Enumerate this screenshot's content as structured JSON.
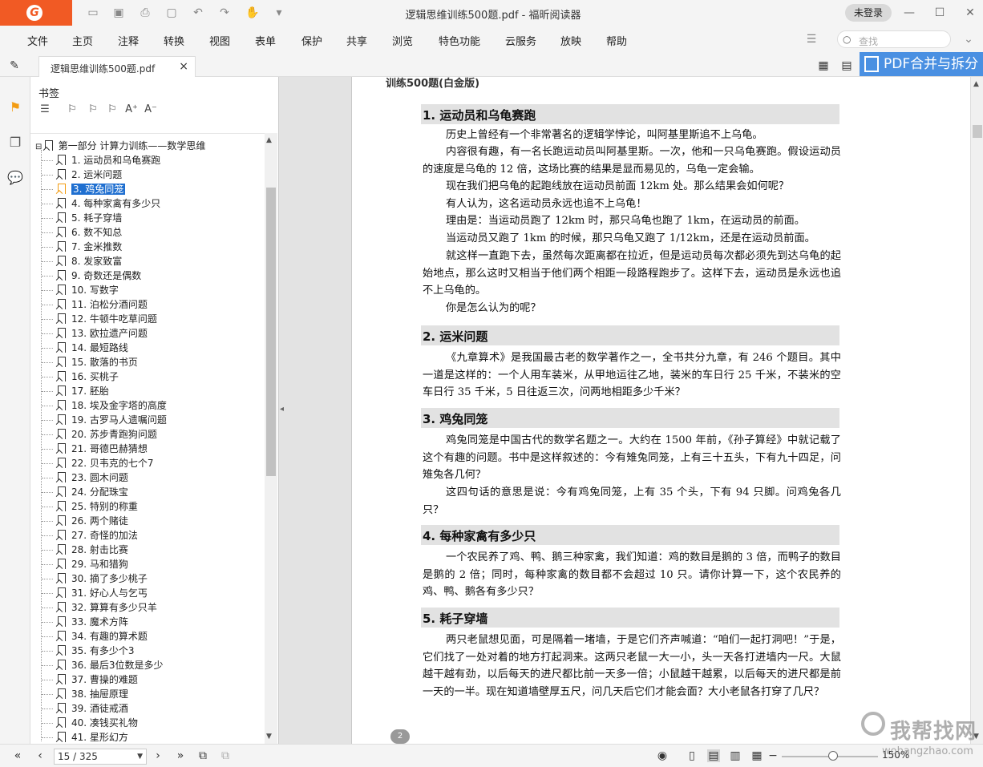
{
  "titlebar": {
    "logo": "foxit-logo",
    "quick_access_icons": [
      "open-icon",
      "save-icon",
      "print-icon",
      "new-icon",
      "undo-icon",
      "redo-icon",
      "hand-tool-icon",
      "customize-icon"
    ],
    "title": "逻辑思维训练500题.pdf - 福昕阅读器",
    "login": "未登录",
    "window_buttons": {
      "minimize": "—",
      "maximize": "☐",
      "close": "✕"
    }
  },
  "menu": {
    "items": [
      "文件",
      "主页",
      "注释",
      "转换",
      "视图",
      "表单",
      "保护",
      "共享",
      "浏览",
      "特色功能",
      "云服务",
      "放映",
      "帮助"
    ],
    "search_placeholder": "查找"
  },
  "tabs": {
    "doc_tab": "逻辑思维训练500题.pdf",
    "close": "×",
    "promo": "PDF合并与拆分"
  },
  "bookmarks": {
    "title": "书签",
    "root": "第一部分 计算力训练——数学思维",
    "selected_index": 2,
    "items": [
      "1. 运动员和乌龟赛跑",
      "2. 运米问题",
      "3. 鸡兔同笼",
      "4. 每种家禽有多少只",
      "5. 耗子穿墙",
      "6. 数不知总",
      "7. 金米推数",
      "8. 发家致富",
      "9. 奇数还是偶数",
      "10. 写数字",
      "11. 泊松分酒问题",
      "12. 牛顿牛吃草问题",
      "13. 欧拉遗产问题",
      "14. 最短路线",
      "15. 散落的书页",
      "16. 买桃子",
      "17. 胚胎",
      "18. 埃及金字塔的高度",
      "19. 古罗马人遗嘱问题",
      "20. 苏步青跑狗问题",
      "21. 哥德巴赫猜想",
      "22. 贝韦克的七个7",
      "23. 圆木问题",
      "24. 分配珠宝",
      "25. 特别的称重",
      "26. 两个赌徒",
      "27. 奇怪的加法",
      "28. 射击比赛",
      "29. 马和猎狗",
      "30. 摘了多少桃子",
      "31. 好心人与乞丐",
      "32. 算算有多少只羊",
      "33. 魔术方阵",
      "34. 有趣的算术题",
      "35. 有多少个3",
      "36. 最后3位数是多少",
      "37. 曹操的难题",
      "38. 抽屉原理",
      "39. 酒徒戒酒",
      "40. 凑钱买礼物",
      "41. 星形幻方"
    ]
  },
  "page": {
    "header": "训练500题(白金版)",
    "page_mark": "2",
    "sections": [
      {
        "title": "1. 运动员和乌龟赛跑",
        "paragraphs": [
          "历史上曾经有一个非常著名的逻辑学悖论，叫阿基里斯追不上乌龟。",
          "内容很有趣，有一名长跑运动员叫阿基里斯。一次，他和一只乌龟赛跑。假设运动员的速度是乌龟的 12 倍，这场比赛的结果是显而易见的，乌龟一定会输。",
          "现在我们把乌龟的起跑线放在运动员前面 12km 处。那么结果会如何呢？",
          "有人认为，这名运动员永远也追不上乌龟！",
          "理由是：当运动员跑了 12km 时，那只乌龟也跑了 1km，在运动员的前面。",
          "当运动员又跑了 1km 的时候，那只乌龟又跑了 1/12km，还是在运动员前面。",
          "就这样一直跑下去，虽然每次距离都在拉近，但是运动员每次都必须先到达乌龟的起始地点，那么这时又相当于他们两个相距一段路程跑步了。这样下去，运动员是永远也追不上乌龟的。",
          "你是怎么认为的呢？"
        ]
      },
      {
        "title": "2. 运米问题",
        "paragraphs": [
          "《九章算术》是我国最古老的数学著作之一，全书共分九章，有 246 个题目。其中一道是这样的：一个人用车装米，从甲地运往乙地，装米的车日行 25 千米，不装米的空车日行 35 千米，5 日往返三次，问两地相距多少千米？"
        ]
      },
      {
        "title": "3. 鸡兔同笼",
        "paragraphs": [
          "鸡兔同笼是中国古代的数学名题之一。大约在 1500 年前，《孙子算经》中就记载了这个有趣的问题。书中是这样叙述的：今有雉兔同笼，上有三十五头，下有九十四足，问雉兔各几何？",
          "这四句话的意思是说：今有鸡兔同笼，上有 35 个头，下有 94 只脚。问鸡兔各几只？"
        ]
      },
      {
        "title": "4. 每种家禽有多少只",
        "paragraphs": [
          "一个农民养了鸡、鸭、鹅三种家禽，我们知道：鸡的数目是鹅的 3 倍，而鸭子的数目是鹅的 2 倍；同时，每种家禽的数目都不会超过 10 只。请你计算一下，这个农民养的鸡、鸭、鹅各有多少只？"
        ]
      },
      {
        "title": "5. 耗子穿墙",
        "paragraphs": [
          "两只老鼠想见面，可是隔着一堵墙，于是它们齐声喊道：“咱们一起打洞吧！”于是，它们找了一处对着的地方打起洞来。这两只老鼠一大一小，头一天各打进墙内一尺。大鼠越干越有劲，以后每天的进尺都比前一天多一倍；小鼠越干越累，以后每天的进尺都是前一天的一半。现在知道墙壁厚五尺，问几天后它们才能会面？大小老鼠各打穿了几尺？"
        ]
      }
    ]
  },
  "statusbar": {
    "page_input": "15 / 325",
    "zoom": "150%"
  },
  "watermark": {
    "cn": "我帮找网",
    "en": "wobangzhao.com"
  }
}
